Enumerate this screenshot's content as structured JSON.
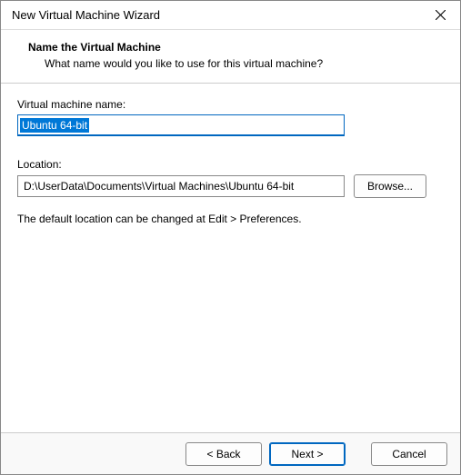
{
  "titlebar": {
    "title": "New Virtual Machine Wizard"
  },
  "header": {
    "title": "Name the Virtual Machine",
    "subtitle": "What name would you like to use for this virtual machine?"
  },
  "fields": {
    "name_label": "Virtual machine name:",
    "name_value": "Ubuntu 64-bit",
    "location_label": "Location:",
    "location_value": "D:\\UserData\\Documents\\Virtual Machines\\Ubuntu 64-bit",
    "browse_label": "Browse..."
  },
  "hint": "The default location can be changed at Edit > Preferences.",
  "footer": {
    "back": "< Back",
    "next": "Next >",
    "cancel": "Cancel"
  }
}
